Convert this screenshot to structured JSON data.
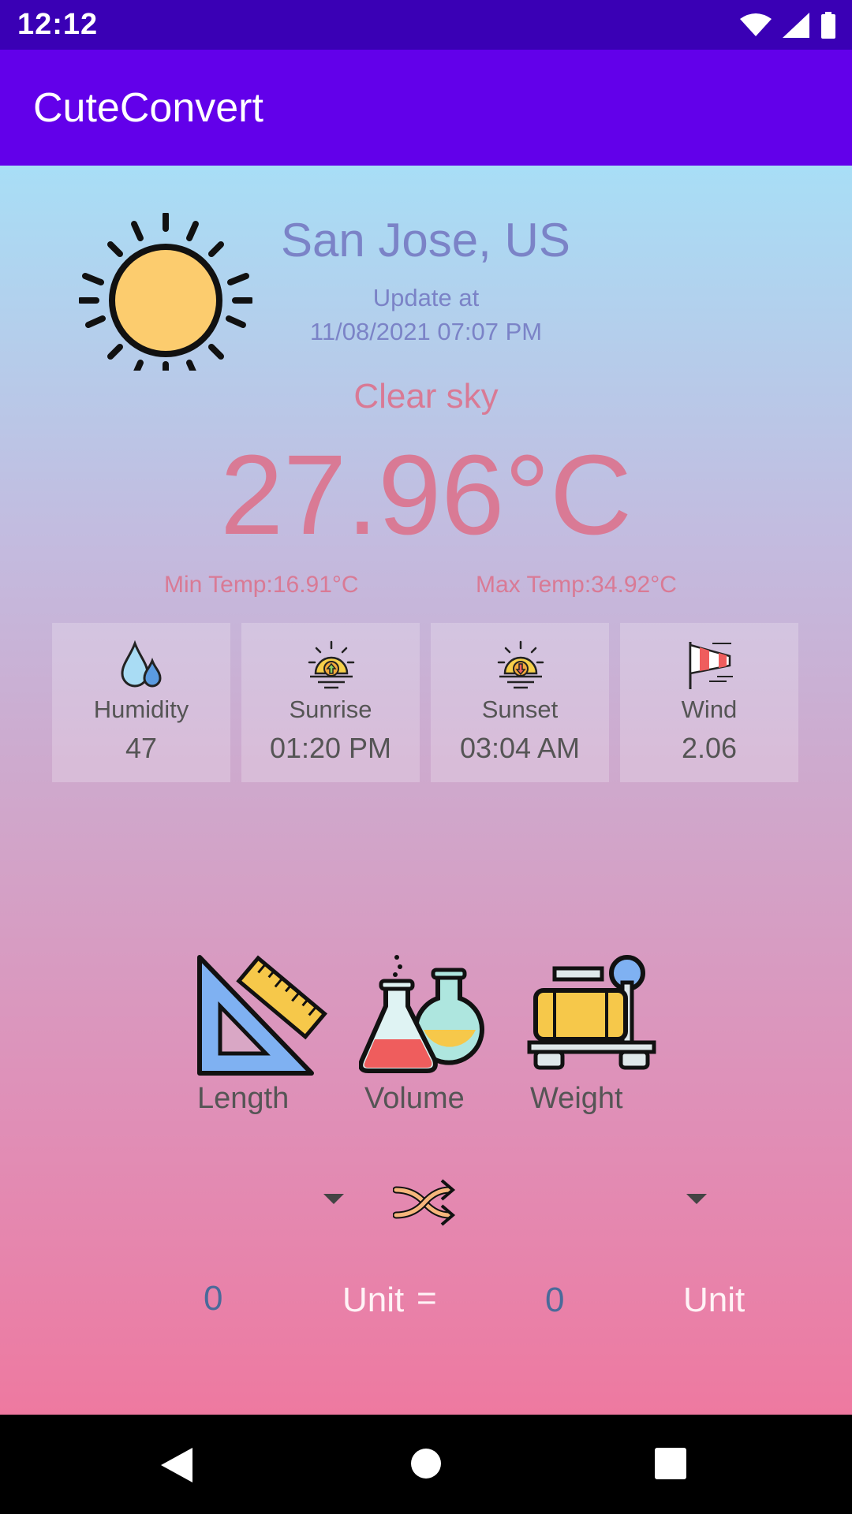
{
  "status_bar": {
    "time": "12:12"
  },
  "app_bar": {
    "title": "CuteConvert"
  },
  "weather": {
    "city": "San Jose, US",
    "update_label": "Update at",
    "update_time": "11/08/2021 07:07 PM",
    "description": "Clear sky",
    "temperature": "27.96°C",
    "min_temp": "Min Temp:16.91°C",
    "max_temp": "Max Temp:34.92°C",
    "stats": [
      {
        "label": "Humidity",
        "value": "47",
        "icon": "humidity-icon"
      },
      {
        "label": "Sunrise",
        "value": "01:20 PM",
        "icon": "sunrise-icon"
      },
      {
        "label": "Sunset",
        "value": "03:04 AM",
        "icon": "sunset-icon"
      },
      {
        "label": "Wind",
        "value": "2.06",
        "icon": "windsock-icon"
      }
    ]
  },
  "converter": {
    "categories": [
      {
        "label": "Length",
        "icon": "ruler-triangle-icon"
      },
      {
        "label": "Volume",
        "icon": "flask-icon"
      },
      {
        "label": "Weight",
        "icon": "scale-icon"
      }
    ],
    "input_value": "0",
    "input_unit": "Unit",
    "equals": "=",
    "output_value": "0",
    "output_unit": "Unit"
  },
  "colors": {
    "status_bar": "#3a00b5",
    "app_bar": "#6200ea",
    "accent_pink": "#d97a95",
    "accent_blue": "#7b83c7"
  }
}
